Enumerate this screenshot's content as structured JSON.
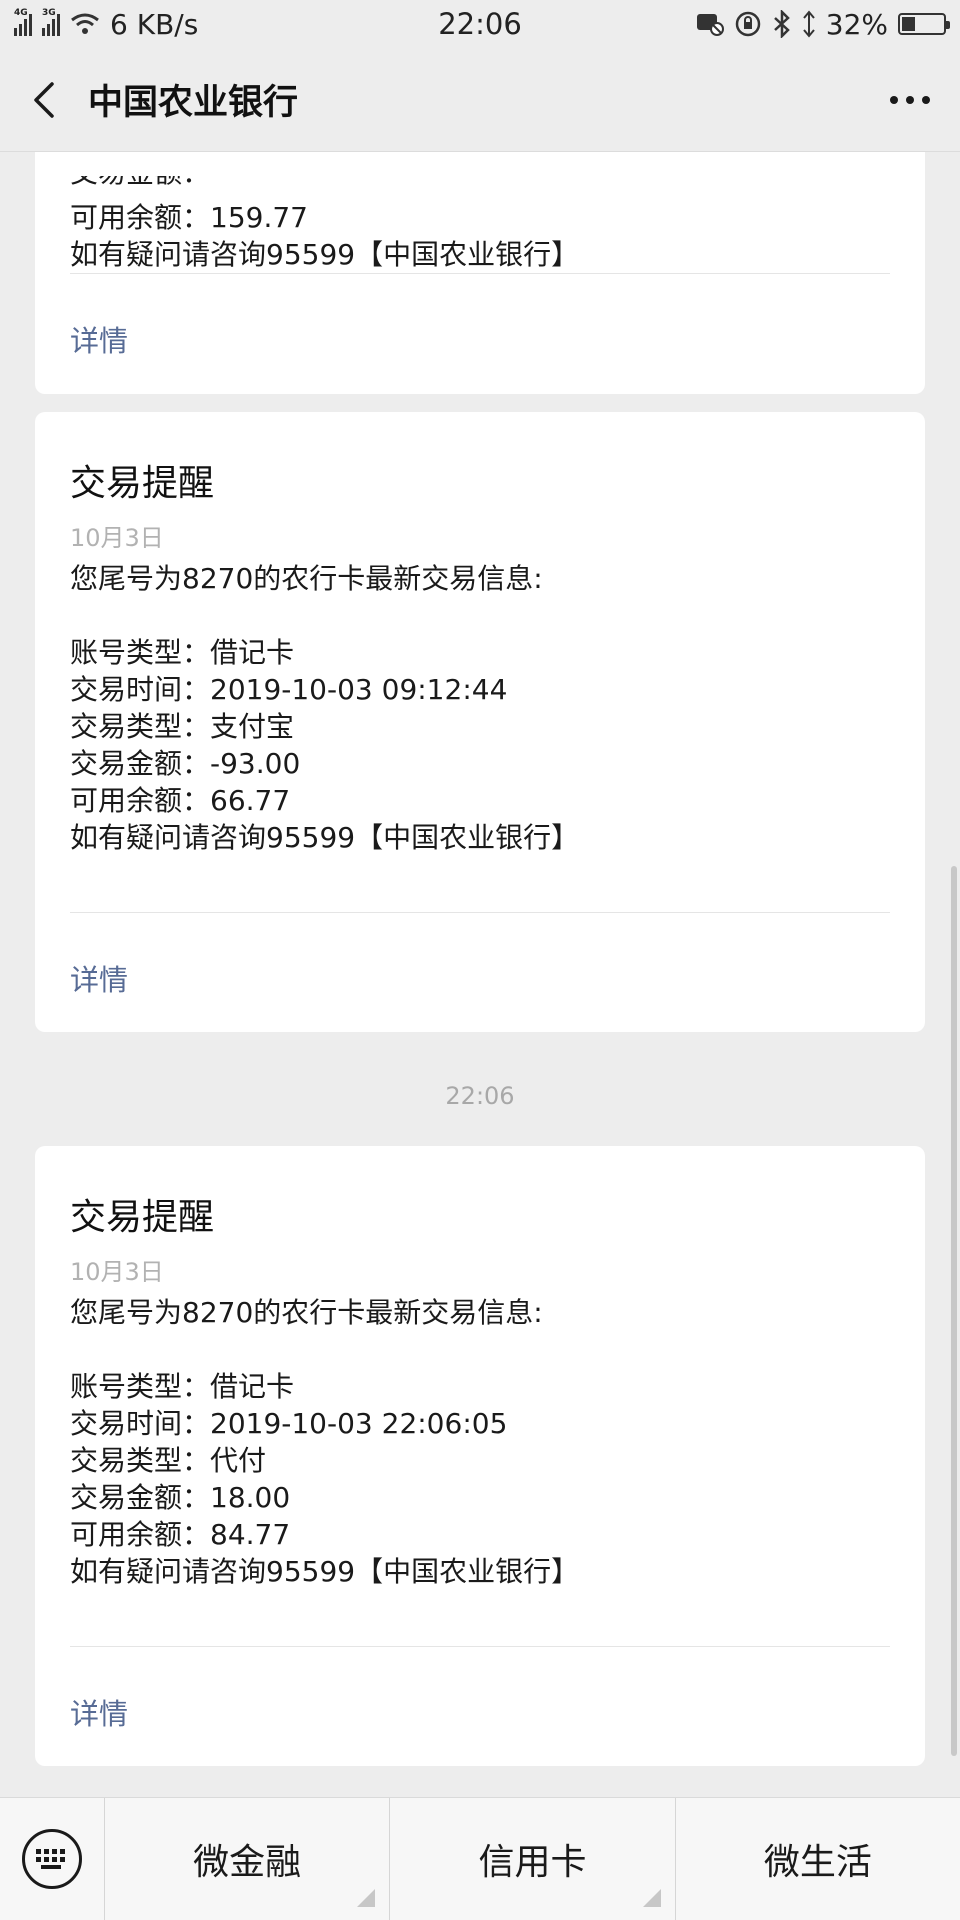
{
  "status_bar": {
    "network_a": "4G",
    "network_b": "3G",
    "speed": "6 KB/s",
    "time": "22:06",
    "battery": "32%",
    "battery_level": 0.32
  },
  "nav": {
    "title": "中国农业银行"
  },
  "cards": [
    {
      "title": "",
      "date": "",
      "intro": "",
      "lines": [
        "交易金额：",
        "可用余额：159.77",
        "如有疑问请咨询95599【中国农业银行】"
      ],
      "detail": "详情"
    },
    {
      "title": "交易提醒",
      "date": "10月3日",
      "intro": "您尾号为8270的农行卡最新交易信息:",
      "lines": [
        "账号类型：借记卡",
        "交易时间：2019-10-03 09:12:44",
        "交易类型：支付宝",
        "交易金额：-93.00",
        "可用余额：66.77",
        "如有疑问请咨询95599【中国农业银行】"
      ],
      "detail": "详情"
    },
    {
      "title": "交易提醒",
      "date": "10月3日",
      "intro": "您尾号为8270的农行卡最新交易信息:",
      "lines": [
        "账号类型：借记卡",
        "交易时间：2019-10-03 22:06:05",
        "交易类型：代付",
        "交易金额：18.00",
        "可用余额：84.77",
        "如有疑问请咨询95599【中国农业银行】"
      ],
      "detail": "详情"
    }
  ],
  "timestamp": "22:06",
  "bottom_menu": [
    "微金融",
    "信用卡",
    "微生活"
  ],
  "icons": {
    "back": "back-arrow-icon",
    "more": "more-dots-icon",
    "keyboard": "keyboard-icon"
  },
  "colors": {
    "background": "#ededed",
    "card": "#ffffff",
    "link": "#576b95",
    "muted": "#b2b2b2"
  }
}
